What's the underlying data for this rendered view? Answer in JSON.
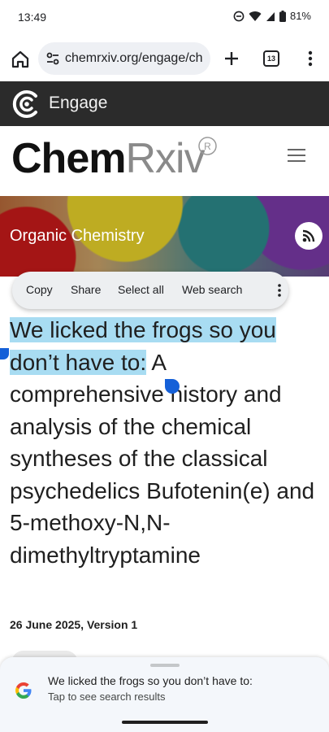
{
  "status_bar": {
    "time": "13:49",
    "battery": "81%",
    "icons": [
      "do-not-disturb-icon",
      "wifi-icon",
      "signal-icon",
      "battery-icon"
    ]
  },
  "browser": {
    "url": "chemrxiv.org/engage/ch",
    "tab_count": "13",
    "icons": [
      "home-icon",
      "site-settings-icon",
      "new-tab-plus-icon",
      "tab-switcher-icon",
      "overflow-menu-icon"
    ]
  },
  "engage_bar": {
    "label": "Engage",
    "bg_color": "#2b2b2b"
  },
  "site_header": {
    "logo_chem": "Chem",
    "logo_rxiv": "Rxiv",
    "logo_reg": "R"
  },
  "banner": {
    "category": "Organic Chemistry"
  },
  "selection_menu": {
    "items": [
      "Copy",
      "Share",
      "Select all",
      "Web search"
    ]
  },
  "article": {
    "title_selected": "We licked the frogs so you don’t have to:",
    "title_rest": " A comprehensive history and analysis of the chemical syntheses of the classical psychedelics Bufotenin(e) and 5-methoxy-N,N-dimethyltryptamine",
    "date_version": "26 June 2025, Version 1",
    "highlight_color": "#a8dcf2"
  },
  "search_sheet": {
    "query": "We licked the frogs so you don’t have to:",
    "hint": "Tap to see search results"
  }
}
